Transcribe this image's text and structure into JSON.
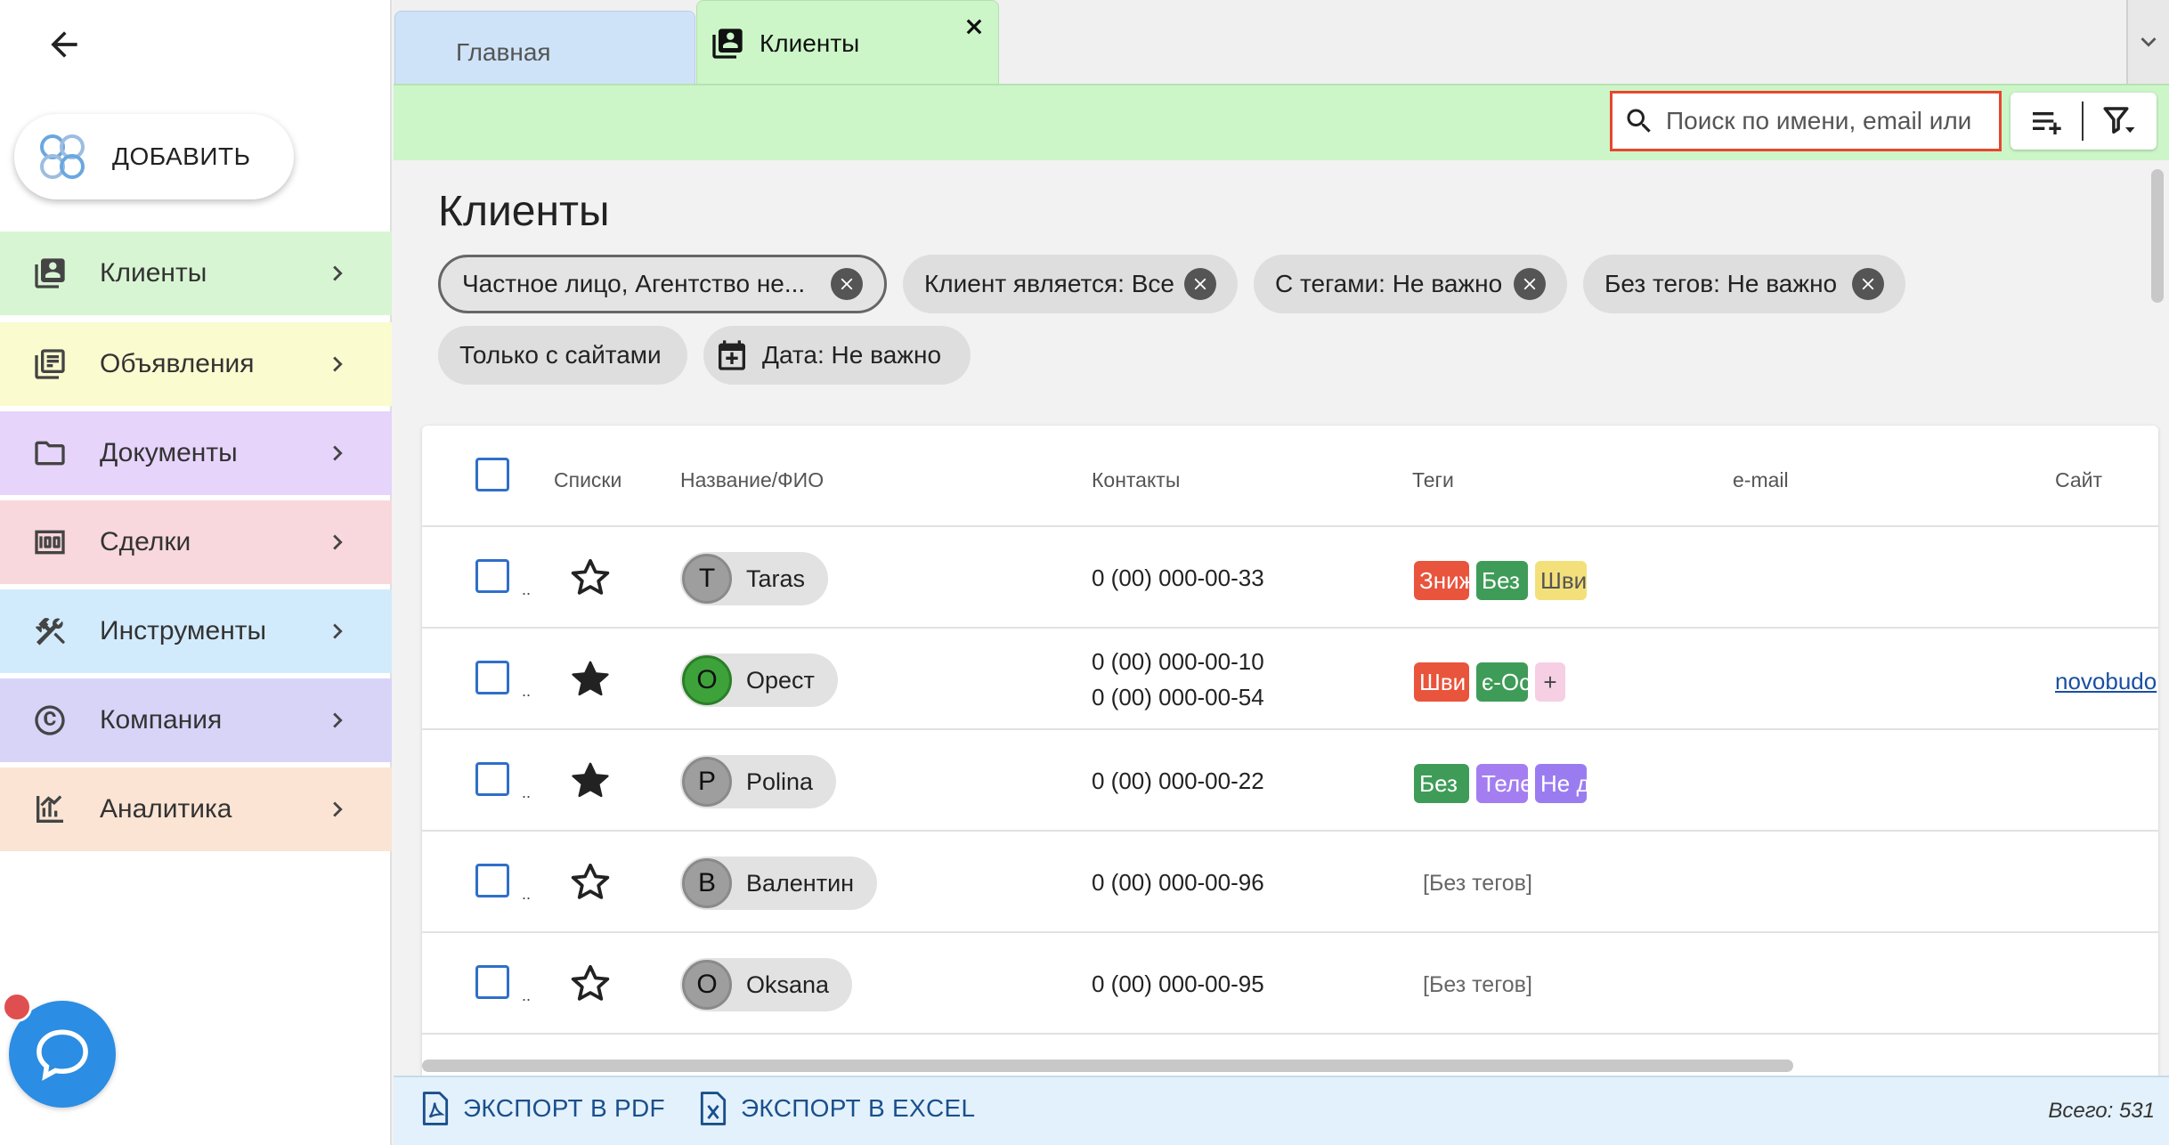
{
  "sidebar": {
    "add_label": "ДОБАВИТЬ",
    "items": [
      {
        "label": "Клиенты",
        "icon": "contacts-icon",
        "color": "#d8f5d3"
      },
      {
        "label": "Объявления",
        "icon": "listings-icon",
        "color": "#fbfbd0"
      },
      {
        "label": "Документы",
        "icon": "folder-icon",
        "color": "#e6d4fb"
      },
      {
        "label": "Сделки",
        "icon": "money-icon",
        "color": "#f8d8dc"
      },
      {
        "label": "Инструменты",
        "icon": "tools-icon",
        "color": "#d2ebfc"
      },
      {
        "label": "Компания",
        "icon": "copyright-icon",
        "color": "#d8d4f8"
      },
      {
        "label": "Аналитика",
        "icon": "analytics-icon",
        "color": "#fbe4d4"
      }
    ]
  },
  "tabs": {
    "home": "Главная",
    "clients": "Клиенты"
  },
  "search": {
    "placeholder": "Поиск по имени, email или"
  },
  "main": {
    "title": "Клиенты",
    "filters": [
      "Частное лицо, Агентство не...",
      "Клиент является: Все",
      "С тегами: Не важно",
      "Без тегов: Не важно",
      "Только с сайтами",
      "Дата: Не важно"
    ]
  },
  "table": {
    "headers": {
      "lists": "Списки",
      "name": "Название/ФИО",
      "contacts": "Контакты",
      "tags": "Теги",
      "email": "e-mail",
      "site": "Сайт"
    },
    "row_marker": "..",
    "no_tags": "[Без тегов]",
    "rows": [
      {
        "initial": "T",
        "name": "Taras",
        "favorite": false,
        "phones": [
          "0 (00) 000-00-33"
        ],
        "tags": [
          {
            "text": "Зниж",
            "color": "#e9543c"
          },
          {
            "text": "Без",
            "color": "#3f9c58"
          },
          {
            "text": "Шви",
            "color": "#f3e07a"
          }
        ],
        "site": ""
      },
      {
        "initial": "О",
        "name": "Орест",
        "favorite": true,
        "phones": [
          "0 (00) 000-00-10",
          "0 (00) 000-00-54"
        ],
        "tags": [
          {
            "text": "Шви",
            "color": "#e9543c"
          },
          {
            "text": "є-Ос",
            "color": "#3f9c58"
          },
          {
            "text": "+",
            "color": "#f6cfe4"
          }
        ],
        "site": "novobudo"
      },
      {
        "initial": "P",
        "name": "Polina",
        "favorite": true,
        "phones": [
          "0 (00) 000-00-22"
        ],
        "tags": [
          {
            "text": "Без",
            "color": "#3f9c58"
          },
          {
            "text": "Теле",
            "color": "#a47ef0"
          },
          {
            "text": "Не д",
            "color": "#9a7cf0"
          }
        ],
        "site": ""
      },
      {
        "initial": "В",
        "name": "Валентин",
        "favorite": false,
        "phones": [
          "0 (00) 000-00-96"
        ],
        "tags": [],
        "site": ""
      },
      {
        "initial": "O",
        "name": "Oksana",
        "favorite": false,
        "phones": [
          "0 (00) 000-00-95"
        ],
        "tags": [],
        "site": ""
      }
    ]
  },
  "footer": {
    "export_pdf": "ЭКСПОРТ В PDF",
    "export_excel": "ЭКСПОРТ В EXCEL",
    "total": "Всего: 531"
  },
  "colors": {
    "toolbar": "#ccf6c8",
    "accent_blue": "#2f6fc9",
    "search_border": "#e8462f",
    "chat": "#2b8de3"
  }
}
